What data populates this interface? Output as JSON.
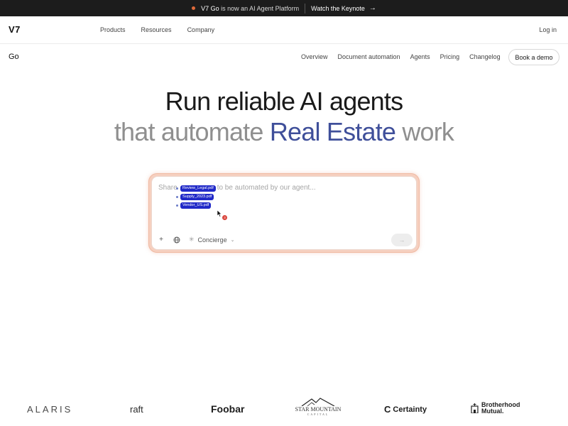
{
  "announcement": {
    "brand": "V7 Go",
    "message": " is now an AI Agent Platform",
    "cta": "Watch the Keynote",
    "cta_arrow": "→"
  },
  "nav": {
    "logo": "V7",
    "links": [
      "Products",
      "Resources",
      "Company"
    ],
    "login": "Log in"
  },
  "subnav": {
    "product": "Go",
    "links": [
      "Overview",
      "Document automation",
      "Agents",
      "Pricing",
      "Changelog"
    ],
    "cta": "Book a demo"
  },
  "hero": {
    "line1": "Run reliable AI agents",
    "line2_pre": "that automate ",
    "line2_accent": "Real Estate",
    "line2_post": " work",
    "accent_color": "#3f4f9a"
  },
  "prompt": {
    "placeholder_start": "Share",
    "placeholder_end": "to be automated by our agent...",
    "files": [
      "Review_Legal.pdf",
      "Supply_2023.pdf",
      "Vendor_US.pdf"
    ],
    "file_count": "3",
    "mode": "Concierge",
    "send_arrow": "→",
    "glow_color": "#f6d0c0"
  },
  "logos": {
    "alaris": "ALARIS",
    "raft": "raft",
    "foobar": "Foobar",
    "star_mountain": "STAR MOUNTAIN",
    "star_mountain_sub": "CAPITAL",
    "certainty": "Certainty",
    "brotherhood_1": "Brotherhood",
    "brotherhood_2": "Mutual."
  }
}
